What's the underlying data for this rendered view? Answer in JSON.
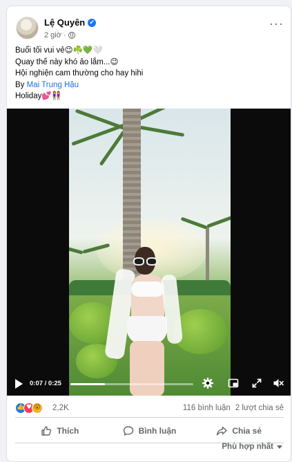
{
  "post": {
    "author": "Lệ Quyên",
    "time": "2 giờ",
    "verified_icon": "✔",
    "more_label": "···",
    "content": {
      "line1": "Buổi tối vui vẻ😉☘️💚🤍",
      "line2": "Quay thế này khó ảo lắm...😉",
      "line3": "Hội nghiện cam thường cho hay hihi",
      "line4_prefix": "By ",
      "line4_link": "Mai Trung Hậu",
      "line5": "Holiday💕👭"
    }
  },
  "video": {
    "current_time": "0:07",
    "duration": "0:25",
    "time_display": "0:07 / 0:25",
    "progress_fraction": 0.28,
    "icons": [
      "play-icon",
      "gear-icon",
      "pip-icon",
      "expand-icon",
      "volume-icon"
    ]
  },
  "stats": {
    "reaction_icons": [
      "like-icon",
      "love-icon",
      "wow-icon"
    ],
    "reaction_count": "2,2K",
    "comments": "116 bình luận",
    "shares": "2 lượt chia sẻ"
  },
  "actions": {
    "like": "Thích",
    "comment": "Bình luận",
    "share": "Chia sẻ"
  },
  "sort": {
    "label": "Phù hợp nhất"
  },
  "colors": {
    "accent": "#1877f2",
    "link": "#216fdb",
    "muted": "#65676b"
  }
}
